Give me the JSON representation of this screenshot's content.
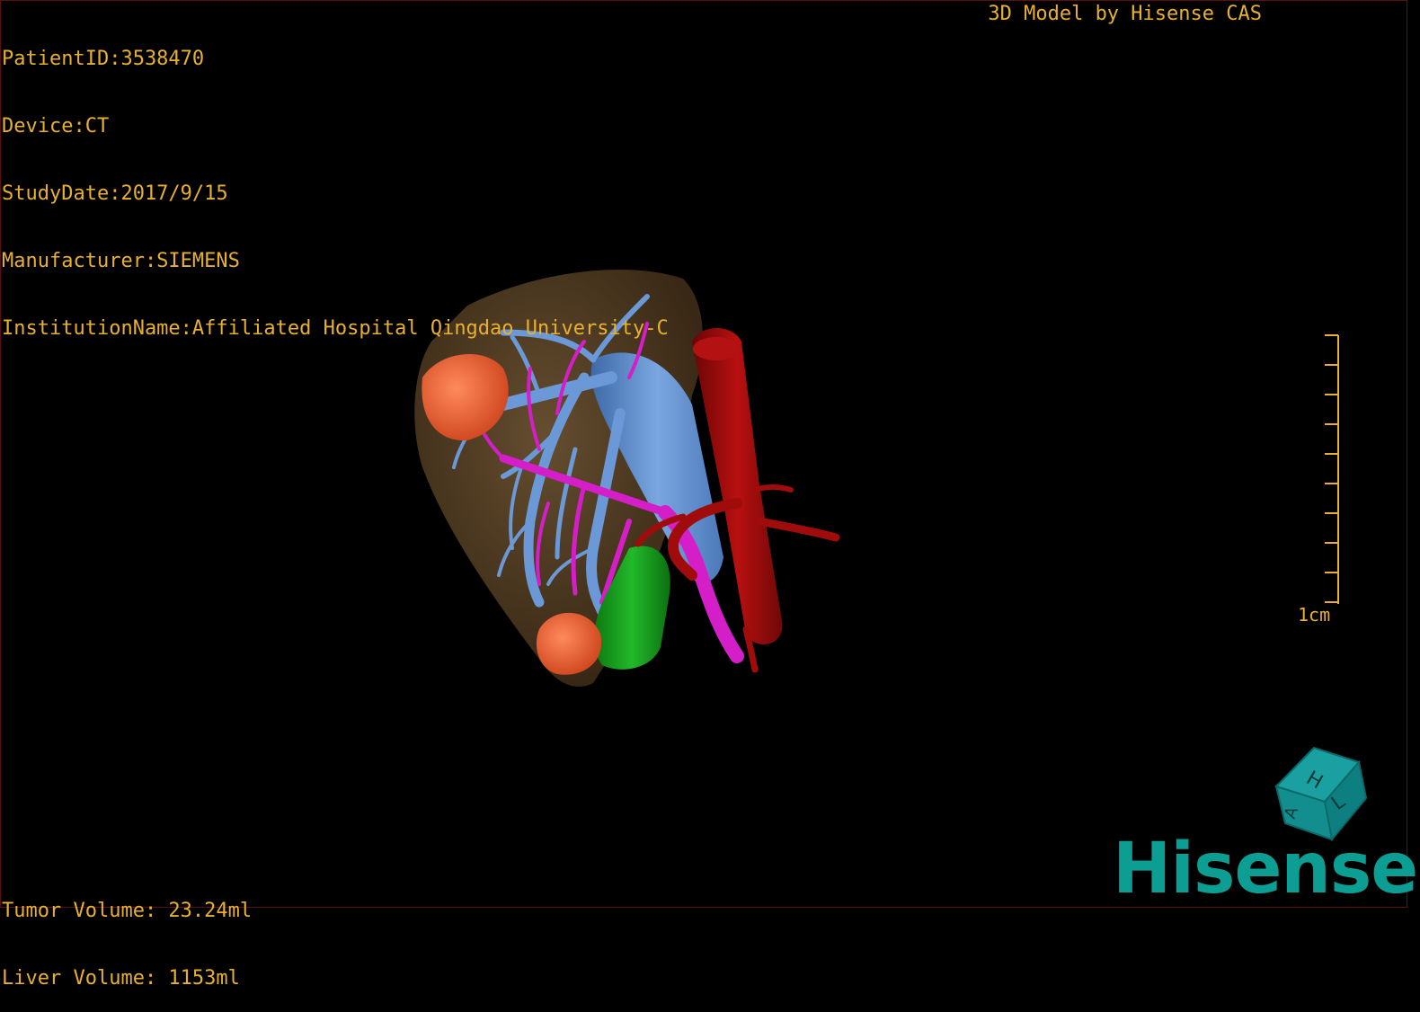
{
  "header": {
    "patient_id": "PatientID:3538470",
    "device": "Device:CT",
    "study_date": "StudyDate:2017/9/15",
    "manufacturer": "Manufacturer:SIEMENS",
    "institution": "InstitutionName:Affiliated Hospital Qingdao University-C",
    "model_credit": "3D Model by Hisense CAS"
  },
  "footer": {
    "tumor_volume": "Tumor Volume: 23.24ml",
    "liver_volume": "Liver Volume: 1153ml"
  },
  "scale": {
    "label": "1cm"
  },
  "orientation": {
    "face_labels": [
      "H",
      "L",
      "A"
    ]
  },
  "brand": {
    "logo_text": "Hisense"
  },
  "colors": {
    "overlay_text": "#e8b030",
    "liver": "#5a4326",
    "portal_vein": "#6b98d6",
    "hepatic_artery": "#d41ec8",
    "aorta_ivc": "#9a0a0a",
    "tumor": "#f0643c",
    "gallbladder": "#129a18",
    "brand": "#0c9e92"
  }
}
